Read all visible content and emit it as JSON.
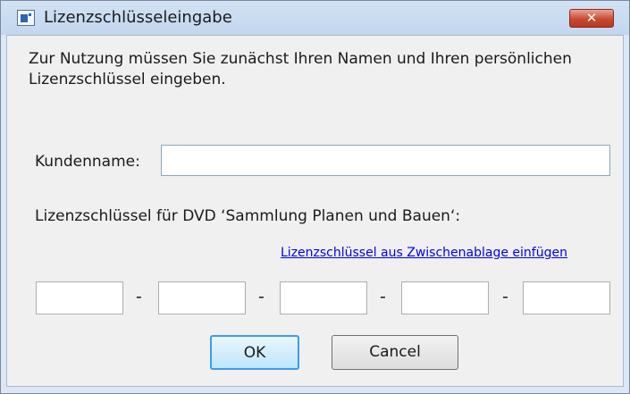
{
  "window": {
    "title": "Lizenzschlüsseleingabe",
    "close_glyph": "✕",
    "app_icon": "dialog-app-icon"
  },
  "intro": {
    "text": "Zur Nutzung müssen Sie zunächst Ihren Namen und Ihren persönlichen Lizenzschlüssel eingeben."
  },
  "customer": {
    "label": "Kundenname:",
    "value": ""
  },
  "license": {
    "label": "Lizenzschlüssel für DVD ‘Sammlung Planen und Bauen‘:",
    "paste_link": "Lizenzschlüssel aus Zwischenablage einfügen",
    "segments": [
      "",
      "",
      "",
      "",
      ""
    ],
    "separator": "-"
  },
  "buttons": {
    "ok": "OK",
    "cancel": "Cancel"
  },
  "colors": {
    "accent": "#3c9ce6",
    "close": "#c84a33",
    "link": "#0000ee"
  }
}
